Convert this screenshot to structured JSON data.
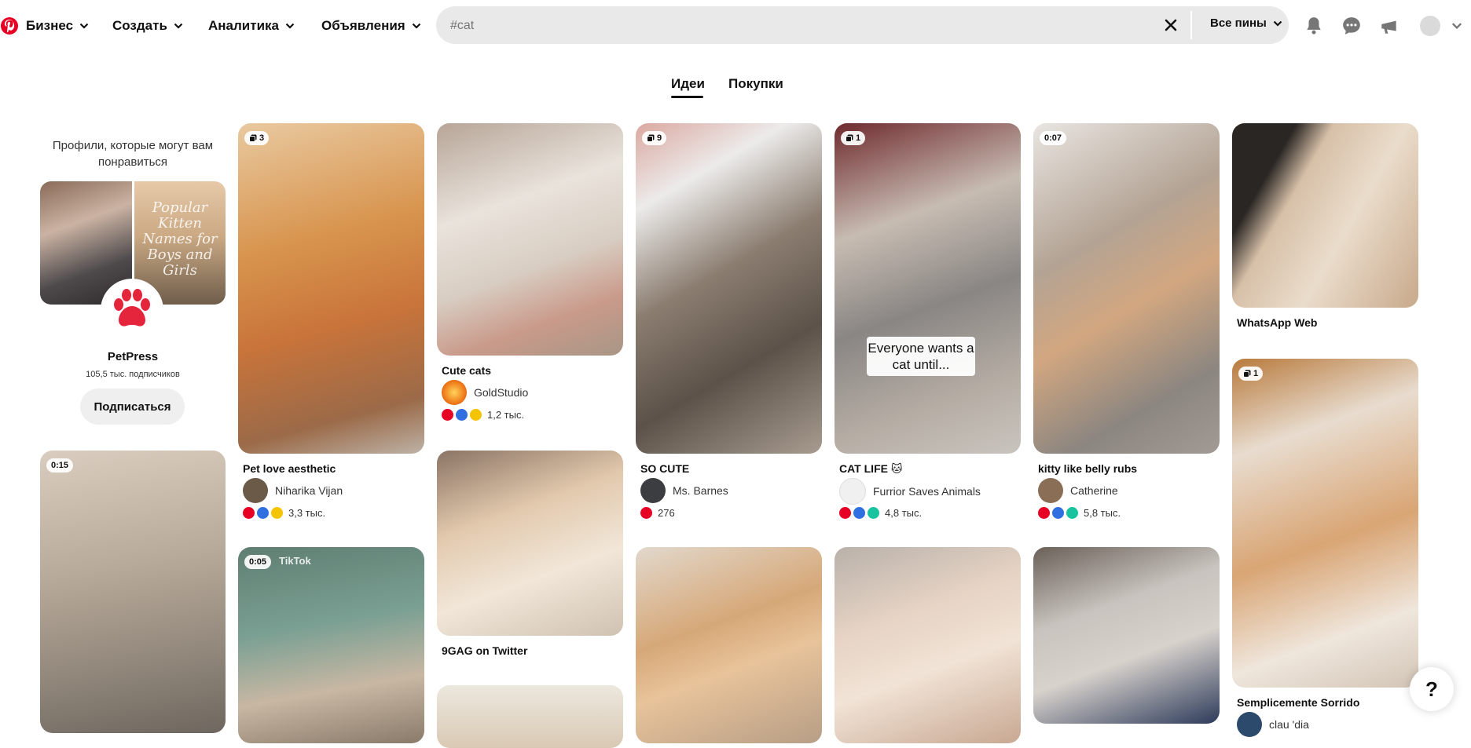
{
  "nav": {
    "business": "Бизнес",
    "create": "Создать",
    "analytics": "Аналитика",
    "ads": "Объявления"
  },
  "search": {
    "value": "#cat",
    "filter": "Все пины"
  },
  "tabs": {
    "ideas": "Идеи",
    "shopping": "Покупки"
  },
  "profile_card": {
    "heading": "Профили, которые могут вам понравиться",
    "collage_caption": "Popular Kitten Names for Boys and Girls",
    "name": "PetPress",
    "followers": "105,5 тыс. подписчиков",
    "follow": "Подписаться"
  },
  "pins": {
    "p1": {
      "badge": "3",
      "title": "Pet love aesthetic",
      "author": "Niharika Vijan",
      "reactions": "3,3 тыс."
    },
    "p2": {
      "title": "Cute cats",
      "author": "GoldStudio",
      "reactions": "1,2 тыс."
    },
    "p3": {
      "badge": "9",
      "title": "SO CUTE",
      "author": "Ms. Barnes",
      "reactions": "276"
    },
    "p4": {
      "badge": "1",
      "overlay": "Everyone wants a cat until...",
      "title": "CAT LIFE 🐱",
      "author": "Furrior Saves Animals",
      "reactions": "4,8 тыс."
    },
    "p5": {
      "badge": "0:07",
      "title": "kitty like belly rubs",
      "author": "Catherine",
      "reactions": "5,8 тыс."
    },
    "p6": {
      "title": "WhatsApp Web"
    },
    "p7": {
      "badge": "1",
      "title": "Semplicemente Sorrido",
      "author": "clau 'dia"
    },
    "p8": {
      "badge": "0:15"
    },
    "p9": {
      "badge": "0:05",
      "watermark": "TikTok"
    },
    "p10": {
      "title": "9GAG on Twitter"
    }
  },
  "icons": {
    "logo": "pinterest-logo",
    "notifications": "bell-icon",
    "messages": "chat-bubble-icon",
    "updates": "megaphone-icon",
    "help": "?"
  },
  "colors": {
    "brand": "#e60023",
    "search_bg": "#e9e9e9"
  }
}
